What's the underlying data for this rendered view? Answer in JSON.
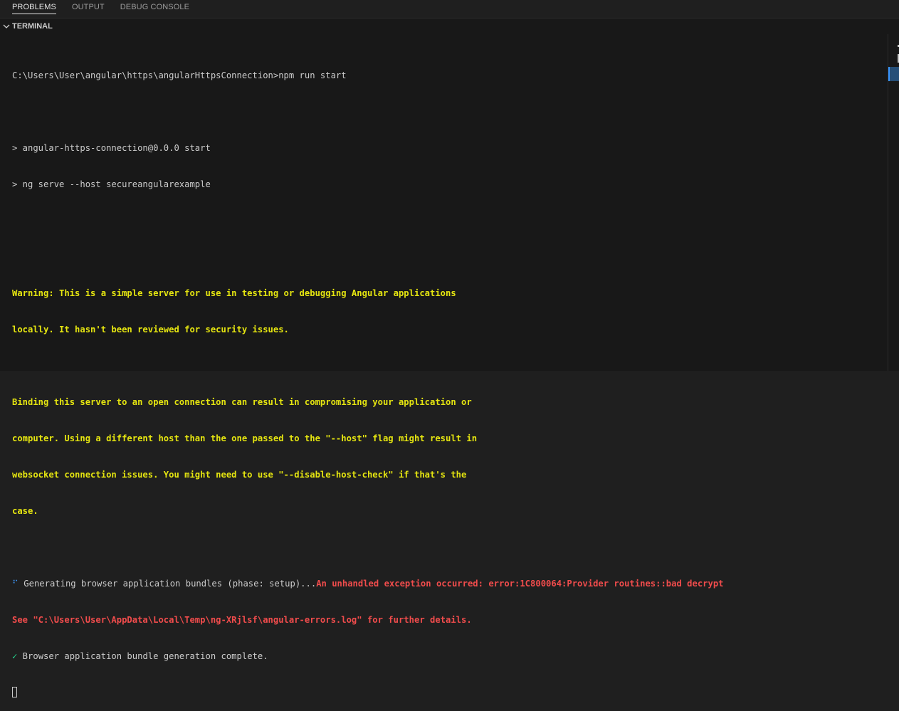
{
  "panel": {
    "tabs": [
      {
        "label": "PROBLEMS",
        "active": true
      },
      {
        "label": "OUTPUT",
        "active": false
      },
      {
        "label": "DEBUG CONSOLE",
        "active": false
      }
    ]
  },
  "terminal": {
    "header_title": "TERMINAL",
    "lines": {
      "prompt": "C:\\Users\\User\\angular\\https\\angularHttpsConnection>npm run start",
      "script_name": "> angular-https-connection@0.0.0 start",
      "script_cmd": "> ng serve --host secureangularexample",
      "warn1": "Warning: This is a simple server for use in testing or debugging Angular applications",
      "warn2": "locally. It hasn't been reviewed for security issues.",
      "bind1": "Binding this server to an open connection can result in compromising your application or",
      "bind2": "computer. Using a different host than the one passed to the \"--host\" flag might result in",
      "bind3": "websocket connection issues. You might need to use \"--disable-host-check\" if that's the",
      "bind4": "case.",
      "spinner_glyph": "⠋",
      "generating": " Generating browser application bundles (phase: setup)...",
      "error": "An unhandled exception occurred: error:1C800064:Provider routines::bad decrypt",
      "see_log": "See \"C:\\Users\\User\\AppData\\Local\\Temp\\ng-XRjlsf\\angular-errors.log\" for further details.",
      "check_glyph": "✓",
      "complete": " Browser application bundle generation complete."
    }
  },
  "colors": {
    "background": "#181818",
    "warning": "#e5e510",
    "error": "#f14c4c",
    "success": "#23d18b",
    "info": "#3b8eea",
    "text": "#cccccc"
  },
  "icons": {
    "header_toggle": "chevron-down-icon"
  }
}
